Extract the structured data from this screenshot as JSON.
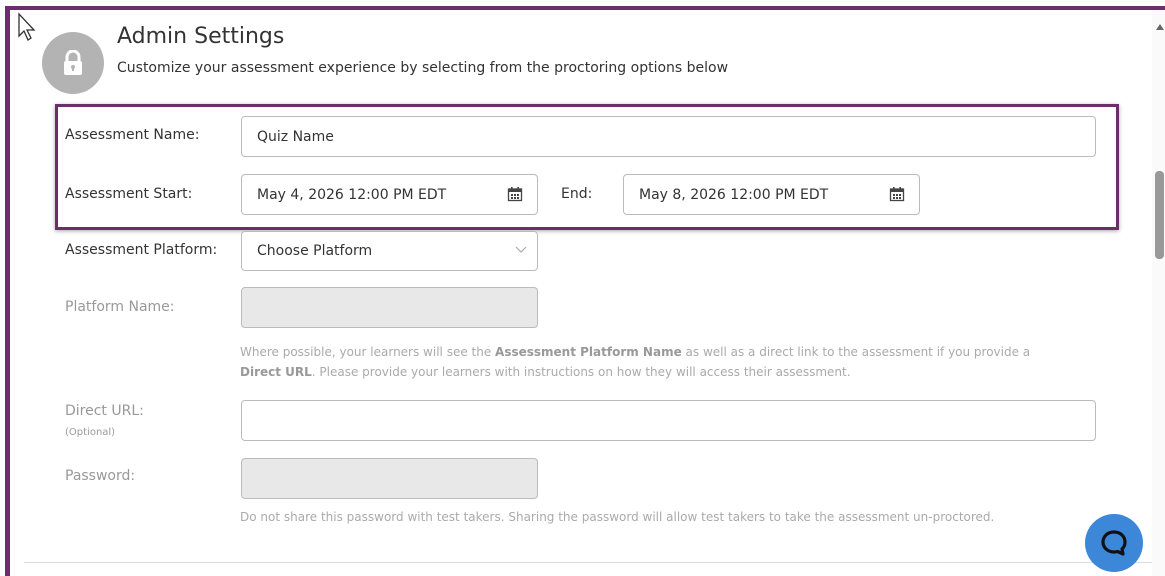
{
  "header": {
    "title": "Admin Settings",
    "subtitle": "Customize your assessment experience by selecting from the proctoring options below"
  },
  "form": {
    "assessment_name_label": "Assessment Name:",
    "assessment_name_value": "Quiz Name",
    "start_label": "Assessment Start:",
    "start_value": "May 4, 2026 12:00 PM EDT",
    "end_label": "End:",
    "end_value": "May 8, 2026 12:00 PM EDT",
    "platform_label": "Assessment Platform:",
    "platform_value": "Choose Platform",
    "platform_name_label": "Platform Name:",
    "platform_name_value": "",
    "helper_part1": "Where possible, your learners will see the ",
    "helper_bold1": "Assessment Platform Name",
    "helper_part2": " as well as a direct link to the assessment if you provide a",
    "helper_bold2": "Direct URL",
    "helper_part3": ". Please provide your learners with instructions on how they will access their assessment.",
    "direct_url_label": "Direct URL:",
    "direct_url_optional": "(Optional)",
    "direct_url_value": "",
    "password_label": "Password:",
    "password_value": "",
    "password_helper": "Do not share this password with test takers. Sharing the password will allow test takers to take the assessment un-proctored."
  },
  "icons": {
    "avatar": "lock-icon",
    "calendar": "calendar-icon",
    "chat": "chat-icon",
    "cursor": "mouse-cursor-icon",
    "dropdown": "chevron-down-icon"
  },
  "colors": {
    "highlight": "#6b2d6b",
    "chat_button": "#3c87d8",
    "avatar_bg": "#b3b3b3"
  }
}
